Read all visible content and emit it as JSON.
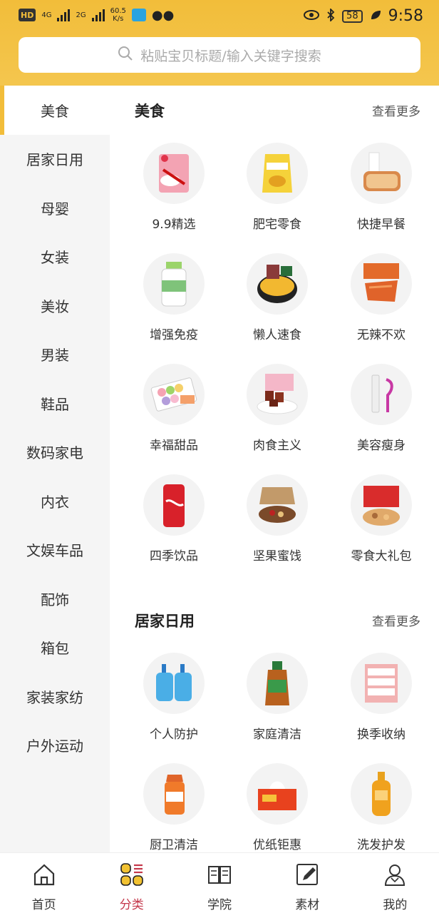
{
  "status_bar": {
    "hd": "HD",
    "net1": "4G",
    "net2": "2G",
    "speed_value": "60.5",
    "speed_unit": "K/s",
    "battery": "58",
    "time": "9:58"
  },
  "search": {
    "placeholder": "粘贴宝贝标题/输入关键字搜索"
  },
  "sidebar": {
    "items": [
      {
        "label": "美食"
      },
      {
        "label": "居家日用"
      },
      {
        "label": "母婴"
      },
      {
        "label": "女装"
      },
      {
        "label": "美妆"
      },
      {
        "label": "男装"
      },
      {
        "label": "鞋品"
      },
      {
        "label": "数码家电"
      },
      {
        "label": "内衣"
      },
      {
        "label": "文娱车品"
      },
      {
        "label": "配饰"
      },
      {
        "label": "箱包"
      },
      {
        "label": "家装家纺"
      },
      {
        "label": "户外运动"
      }
    ],
    "active_index": 0
  },
  "sections": [
    {
      "title": "美食",
      "more": "查看更多",
      "items": [
        {
          "label": "9.9精选",
          "icon": "snack-bag-icon"
        },
        {
          "label": "肥宅零食",
          "icon": "chips-bag-icon"
        },
        {
          "label": "快捷早餐",
          "icon": "bread-milk-icon"
        },
        {
          "label": "增强免疫",
          "icon": "supplement-bottle-icon"
        },
        {
          "label": "懒人速食",
          "icon": "instant-noodle-icon"
        },
        {
          "label": "无辣不欢",
          "icon": "spicy-strips-icon"
        },
        {
          "label": "幸福甜品",
          "icon": "macaron-box-icon"
        },
        {
          "label": "肉食主义",
          "icon": "beef-jerky-icon"
        },
        {
          "label": "美容瘦身",
          "icon": "beauty-tool-icon"
        },
        {
          "label": "四季饮品",
          "icon": "cola-can-icon"
        },
        {
          "label": "坚果蜜饯",
          "icon": "nut-box-icon"
        },
        {
          "label": "零食大礼包",
          "icon": "gift-pack-icon"
        }
      ]
    },
    {
      "title": "居家日用",
      "more": "查看更多",
      "items": [
        {
          "label": "个人防护",
          "icon": "hand-wash-icon"
        },
        {
          "label": "家庭清洁",
          "icon": "disinfectant-bottle-icon"
        },
        {
          "label": "换季收纳",
          "icon": "storage-drawer-icon"
        },
        {
          "label": "厨卫清洁",
          "icon": "spray-cleaner-icon"
        },
        {
          "label": "优纸钜惠",
          "icon": "tissue-box-icon"
        },
        {
          "label": "洗发护发",
          "icon": "shampoo-bottle-icon"
        }
      ]
    }
  ],
  "tabbar": {
    "items": [
      {
        "label": "首页",
        "icon": "home-icon"
      },
      {
        "label": "分类",
        "icon": "category-icon"
      },
      {
        "label": "学院",
        "icon": "book-icon"
      },
      {
        "label": "素材",
        "icon": "edit-icon"
      },
      {
        "label": "我的",
        "icon": "profile-icon"
      }
    ],
    "active_index": 1
  },
  "colors": {
    "header": "#f2bd3a",
    "active_tab": "#c4384b",
    "sidebar_bg": "#f5f5f5"
  }
}
